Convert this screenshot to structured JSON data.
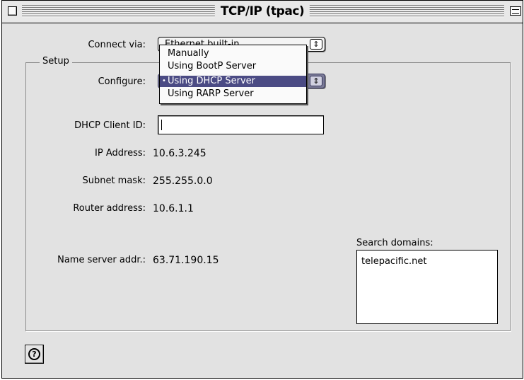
{
  "window": {
    "title": "TCP/IP (tpac)"
  },
  "connect_via": {
    "label": "Connect via:",
    "value": "Ethernet built-in"
  },
  "setup": {
    "group_label": "Setup",
    "configure": {
      "label": "Configure:",
      "value": "Using DHCP Server"
    },
    "dhcp_client_id": {
      "label": "DHCP Client ID:",
      "value": ""
    },
    "ip_address": {
      "label": "IP Address:",
      "value": "10.6.3.245"
    },
    "subnet_mask": {
      "label": "Subnet mask:",
      "value": "255.255.0.0"
    },
    "router_address": {
      "label": "Router address:",
      "value": "10.6.1.1"
    },
    "name_server": {
      "label": "Name server addr.:",
      "value": "63.71.190.15"
    },
    "search_domains": {
      "label": "Search domains:",
      "entries": [
        "telepacific.net"
      ]
    }
  },
  "configure_menu": {
    "items": [
      {
        "label": "Manually",
        "selected": false
      },
      {
        "label": "Using BootP Server",
        "selected": false
      },
      {
        "label": "Using DHCP Server",
        "selected": true
      },
      {
        "label": "Using RARP Server",
        "selected": false
      }
    ],
    "checkmark": "•"
  },
  "help": {
    "glyph": "?"
  },
  "colors": {
    "selection": "#4b4b84",
    "window_bg": "#e2e2e2"
  }
}
